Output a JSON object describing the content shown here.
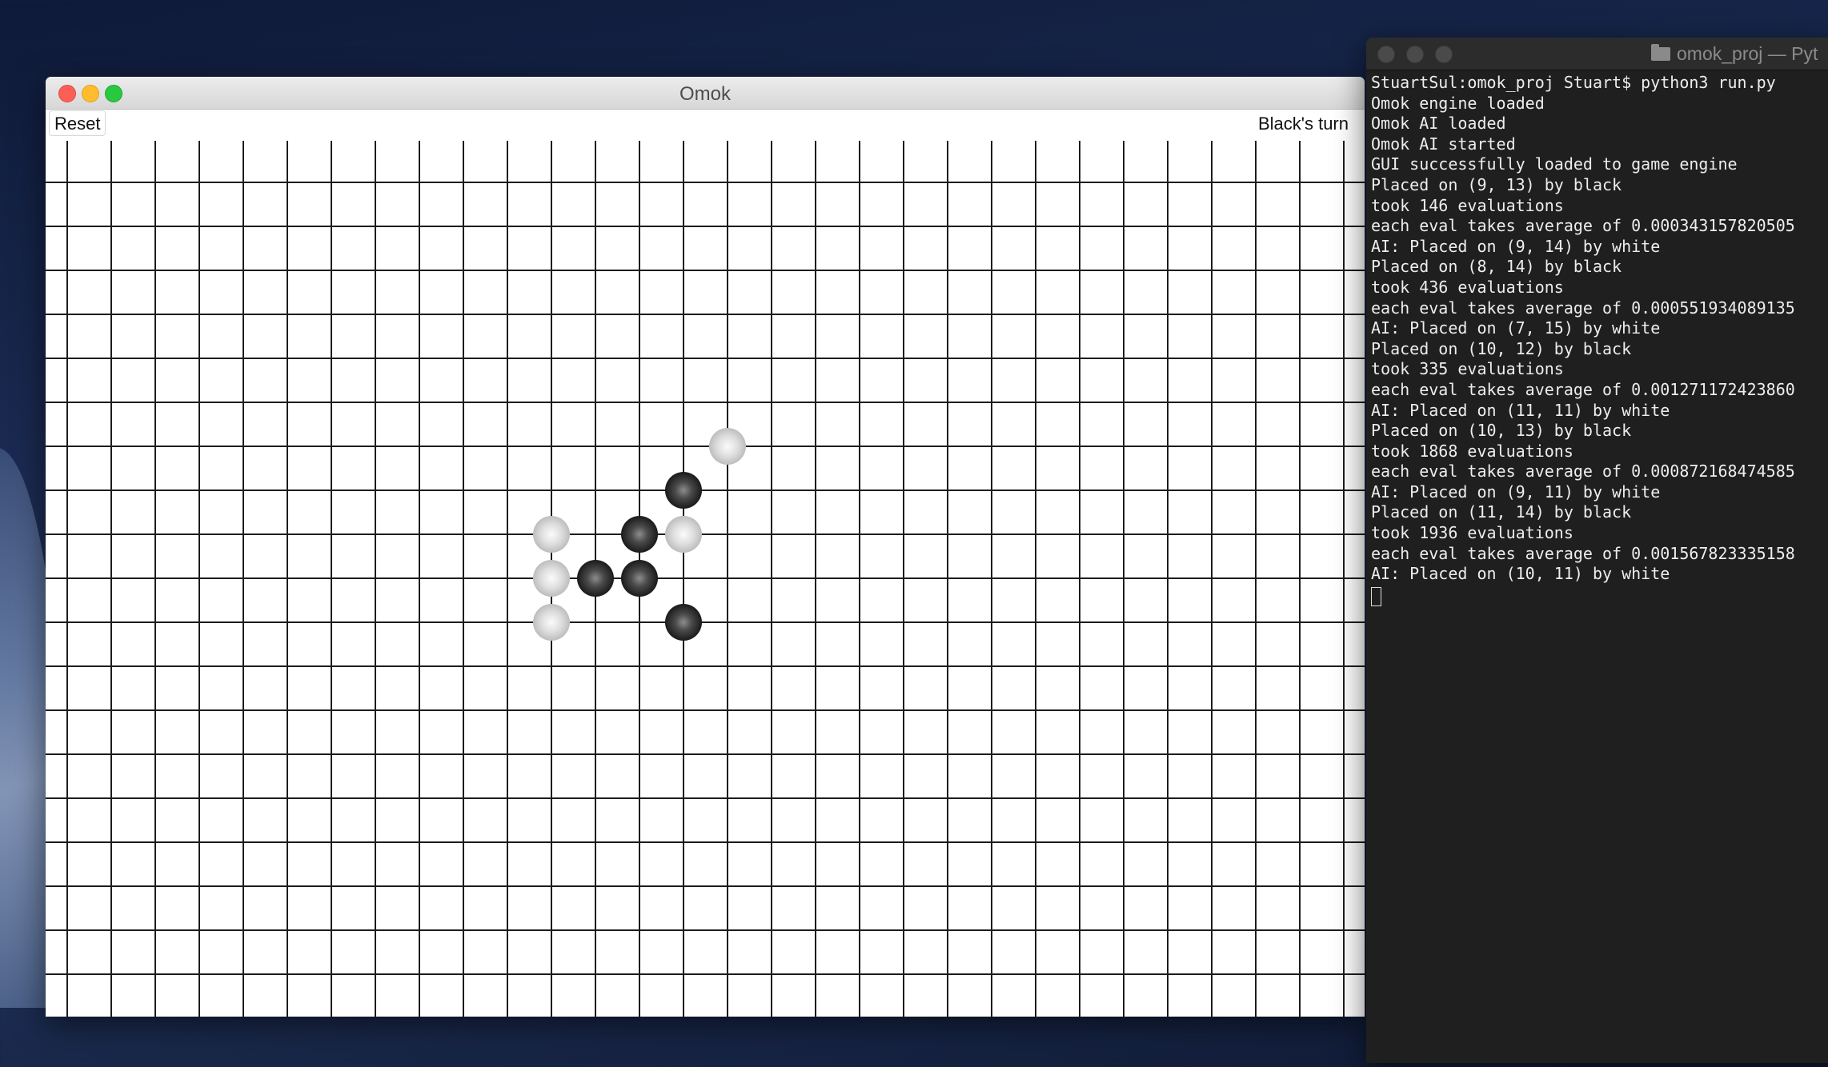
{
  "omok_window": {
    "title": "Omok",
    "reset_label": "Reset",
    "status": "Black's turn",
    "board": {
      "grid_lines": 30,
      "stones": [
        {
          "col": 15,
          "row": 7,
          "color": "white"
        },
        {
          "col": 14,
          "row": 8,
          "color": "black"
        },
        {
          "col": 11,
          "row": 9,
          "color": "white"
        },
        {
          "col": 13,
          "row": 9,
          "color": "black"
        },
        {
          "col": 14,
          "row": 9,
          "color": "white"
        },
        {
          "col": 11,
          "row": 10,
          "color": "white"
        },
        {
          "col": 12,
          "row": 10,
          "color": "black"
        },
        {
          "col": 13,
          "row": 10,
          "color": "black"
        },
        {
          "col": 11,
          "row": 11,
          "color": "white"
        },
        {
          "col": 14,
          "row": 11,
          "color": "black"
        }
      ]
    }
  },
  "terminal_window": {
    "title": "omok_proj — Pyt",
    "lines": [
      "StuartSul:omok_proj Stuart$ python3 run.py",
      "Omok engine loaded",
      "Omok AI loaded",
      "Omok AI started",
      "GUI successfully loaded to game engine",
      "Placed on (9, 13) by black",
      "took 146 evaluations",
      "each eval takes average of 0.000343157820505",
      "AI: Placed on (9, 14) by white",
      "Placed on (8, 14) by black",
      "took 436 evaluations",
      "each eval takes average of 0.000551934089135",
      "AI: Placed on (7, 15) by white",
      "Placed on (10, 12) by black",
      "took 335 evaluations",
      "each eval takes average of 0.001271172423860",
      "AI: Placed on (11, 11) by white",
      "Placed on (10, 13) by black",
      "took 1868 evaluations",
      "each eval takes average of 0.000872168474585",
      "AI: Placed on (9, 11) by white",
      "Placed on (11, 14) by black",
      "took 1936 evaluations",
      "each eval takes average of 0.001567823335158",
      "AI: Placed on (10, 11) by white"
    ]
  }
}
